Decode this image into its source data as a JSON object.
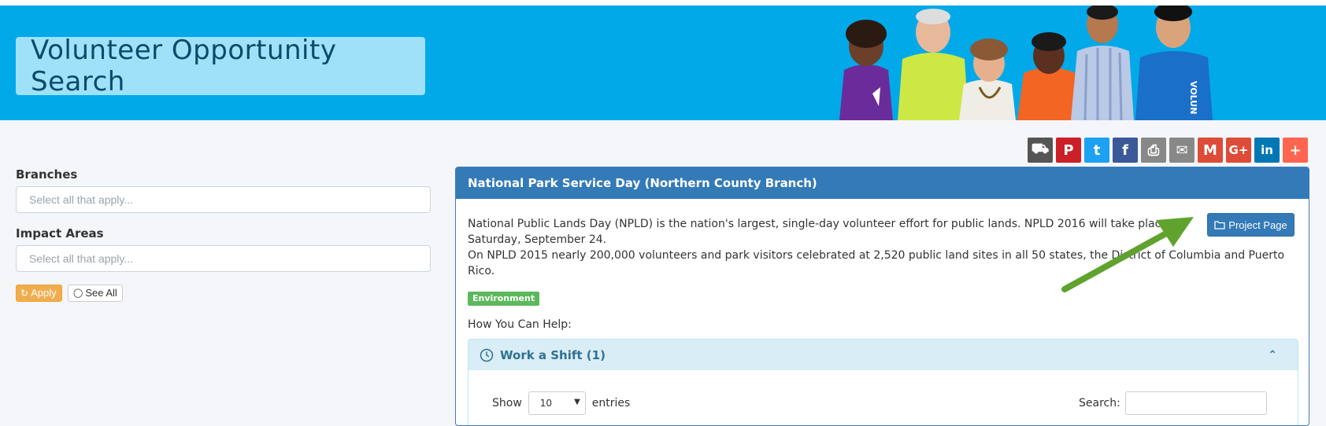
{
  "banner": {
    "title": "Volunteer Opportunity Search"
  },
  "social": [
    {
      "name": "share-icon",
      "bg": "#555555",
      "glyph": "⛟"
    },
    {
      "name": "pinterest-icon",
      "bg": "#cb2027",
      "glyph": "P"
    },
    {
      "name": "twitter-icon",
      "bg": "#1da1f2",
      "glyph": "t"
    },
    {
      "name": "facebook-icon",
      "bg": "#3b5998",
      "glyph": "f"
    },
    {
      "name": "print-icon",
      "bg": "#888888",
      "glyph": "⎙"
    },
    {
      "name": "email-icon",
      "bg": "#888888",
      "glyph": "✉"
    },
    {
      "name": "gmail-icon",
      "bg": "#dd4b39",
      "glyph": "M"
    },
    {
      "name": "google-plus-icon",
      "bg": "#dd4b39",
      "glyph": "G+"
    },
    {
      "name": "linkedin-icon",
      "bg": "#0077b5",
      "glyph": "in"
    },
    {
      "name": "more-icon",
      "bg": "#ff6550",
      "glyph": "+"
    }
  ],
  "sidebar": {
    "branches_label": "Branches",
    "branches_placeholder": "Select all that apply...",
    "impact_label": "Impact Areas",
    "impact_placeholder": "Select all that apply...",
    "apply_label": "Apply",
    "see_all_label": "See All"
  },
  "panel": {
    "title": "National Park Service Day (Northern County Branch)",
    "project_button": "Project Page",
    "desc_line1": "National Public Lands Day (NPLD) is the nation's largest, single-day volunteer effort for public lands. NPLD 2016 will take place on",
    "desc_line2": "Saturday, September 24.",
    "desc_line3": "On NPLD 2015 nearly 200,000 volunteers and park visitors celebrated at 2,520 public land sites in all 50 states, the District of Columbia and Puerto",
    "desc_line4": "Rico.",
    "tag": "Environment",
    "how_label": "How You Can Help:",
    "shift_title": "Work a Shift (1)",
    "show_label": "Show",
    "entries_value": "10",
    "entries_label": "entries",
    "search_label": "Search:"
  },
  "colors": {
    "banner": "#01a9e9",
    "panel_header": "#337ab7",
    "apply_button": "#f0ad4e",
    "tag": "#5cb85c",
    "annotation_arrow": "#5fa32e"
  }
}
